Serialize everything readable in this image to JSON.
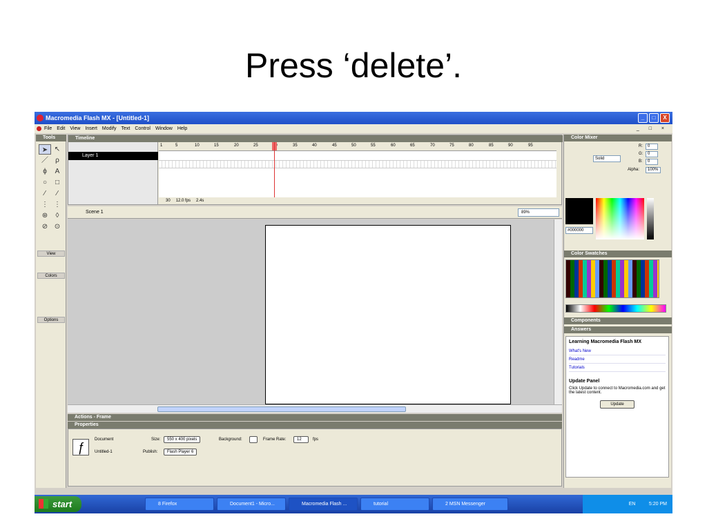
{
  "slide": {
    "title": "Press ‘delete’."
  },
  "window": {
    "title": "Macromedia Flash MX - [Untitled-1]",
    "min": "_",
    "max": "□",
    "close": "X"
  },
  "menu": [
    "File",
    "Edit",
    "View",
    "Insert",
    "Modify",
    "Text",
    "Control",
    "Window",
    "Help"
  ],
  "menu_right": "_ □ ×",
  "tools": {
    "header": "Tools",
    "sections": {
      "view": "View",
      "colors": "Colors",
      "options": "Options"
    },
    "glyphs": [
      "➤",
      "↖",
      "／",
      "ρ",
      "ϕ",
      "A",
      "○",
      "□",
      "⁄",
      "∕",
      "⋮",
      "⋮",
      "⊛",
      "◊",
      "⊘",
      "⊙"
    ]
  },
  "timeline": {
    "header": "Timeline",
    "layer": "Layer 1",
    "ruler": [
      "1",
      "5",
      "10",
      "15",
      "20",
      "25",
      "30",
      "35",
      "40",
      "45",
      "50",
      "55",
      "60",
      "65",
      "70",
      "75",
      "80",
      "85",
      "90",
      "95"
    ],
    "frame": "30",
    "fps": "12.0 fps",
    "time": "2.4s"
  },
  "scene": {
    "label": "Scene 1",
    "zoom": "89%"
  },
  "panels": {
    "actions": "Actions - Frame",
    "properties": "Properties",
    "color_mixer": "Color Mixer",
    "color_swatches": "Color Swatches",
    "components": "Components",
    "answers": "Answers"
  },
  "color_mixer": {
    "fill_type": "Solid",
    "r": "0",
    "g": "0",
    "b": "0",
    "alpha": "100%",
    "hex": "#000000",
    "r_label": "R:",
    "g_label": "G:",
    "b_label": "B:",
    "alpha_label": "Alpha:"
  },
  "properties": {
    "doc_label": "Document",
    "doc_name": "Untitled-1",
    "size_label": "Size:",
    "size_value": "550 x 400 pixels",
    "publish_label": "Publish:",
    "publish_value": "Flash Player 6",
    "bg_label": "Background:",
    "rate_label": "Frame Rate:",
    "rate_value": "12",
    "fps_label": "fps"
  },
  "answers": {
    "heading": "Learning Macromedia Flash MX",
    "links": [
      "What's New",
      "Readme",
      "Tutorials"
    ],
    "update_heading": "Update Panel",
    "update_text": "Click Update to connect to Macromedia.com and get the latest content.",
    "update_button": "Update"
  },
  "taskbar": {
    "start": "start",
    "tasks": [
      "8 Firefox",
      "Document1 - Micro...",
      "Macromedia Flash ...",
      "tutorial",
      "2 MSN Messenger"
    ],
    "lang": "EN",
    "clock": "5:20 PM"
  }
}
